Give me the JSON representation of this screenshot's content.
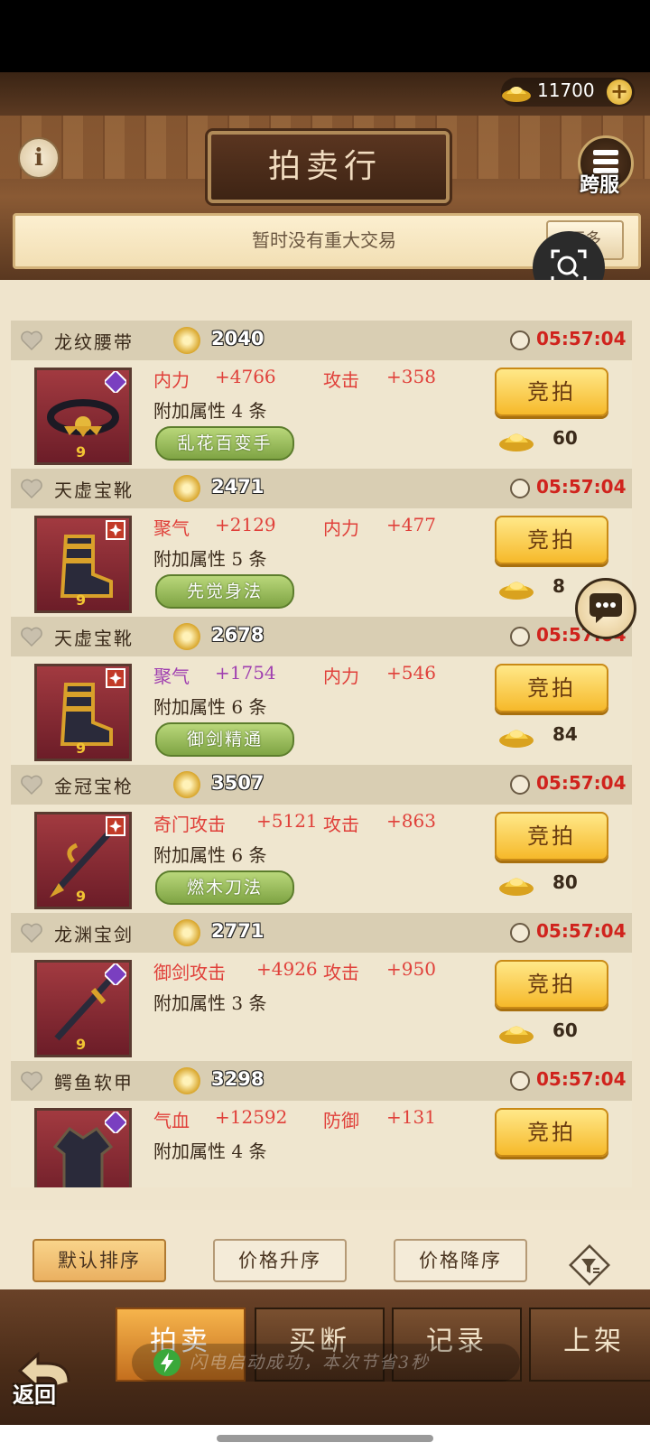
{
  "header": {
    "gold_amount": "11700",
    "plus": "+",
    "title": "拍卖行",
    "info": "i",
    "cross_server": "跨服"
  },
  "notice": {
    "text": "暂时没有重大交易",
    "more": "更多"
  },
  "items": [
    {
      "name": "龙纹腰带",
      "price": "2040",
      "timer": "05:57:04",
      "stat1_label": "内力",
      "stat1_value": "+4766",
      "stat1_color": "#e0403a",
      "stat2_label": "攻击",
      "stat2_value": "+358",
      "stat2_color": "#e0403a",
      "attr": "附加属性 4 条",
      "skill": "乱花百变手",
      "bid_label": "竞拍",
      "bid_cost": "60",
      "icon": "belt-icon",
      "badge": "purple-badge"
    },
    {
      "name": "天虚宝靴",
      "price": "2471",
      "timer": "05:57:04",
      "stat1_label": "聚气",
      "stat1_value": "+2129",
      "stat1_color": "#e0403a",
      "stat2_label": "内力",
      "stat2_value": "+477",
      "stat2_color": "#e0403a",
      "attr": "附加属性 5 条",
      "skill": "先觉身法",
      "bid_label": "竞拍",
      "bid_cost": "8",
      "icon": "boots-icon",
      "badge": "red-badge"
    },
    {
      "name": "天虚宝靴",
      "price": "2678",
      "timer": "05:57:04",
      "stat1_label": "聚气",
      "stat1_value": "+1754",
      "stat1_color": "#a040b0",
      "stat2_label": "内力",
      "stat2_value": "+546",
      "stat2_color": "#e0403a",
      "attr": "附加属性 6 条",
      "skill": "御剑精通",
      "bid_label": "竞拍",
      "bid_cost": "84",
      "icon": "boots-icon",
      "badge": "red-badge"
    },
    {
      "name": "金冠宝枪",
      "price": "3507",
      "timer": "05:57:04",
      "stat1_label": "奇门攻击",
      "stat1_value": "+5121",
      "stat1_color": "#e0403a",
      "stat2_label": "攻击",
      "stat2_value": "+863",
      "stat2_color": "#e0403a",
      "attr": "附加属性 6 条",
      "skill": "燃木刀法",
      "bid_label": "竞拍",
      "bid_cost": "80",
      "icon": "spear-icon",
      "badge": "red-badge"
    },
    {
      "name": "龙渊宝剑",
      "price": "2771",
      "timer": "05:57:04",
      "stat1_label": "御剑攻击",
      "stat1_value": "+4926",
      "stat1_color": "#e0403a",
      "stat2_label": "攻击",
      "stat2_value": "+950",
      "stat2_color": "#e0403a",
      "attr": "附加属性 3 条",
      "skill": "",
      "bid_label": "竞拍",
      "bid_cost": "60",
      "icon": "sword-icon",
      "badge": "purple-badge"
    },
    {
      "name": "鳄鱼软甲",
      "price": "3298",
      "timer": "05:57:04",
      "stat1_label": "气血",
      "stat1_value": "+12592",
      "stat1_color": "#e0403a",
      "stat2_label": "防御",
      "stat2_value": "+131",
      "stat2_color": "#e0403a",
      "attr": "附加属性 4 条",
      "skill": "",
      "bid_label": "竞拍",
      "bid_cost": "",
      "icon": "armor-icon",
      "badge": "purple-badge"
    }
  ],
  "sort": {
    "default": "默认排序",
    "asc": "价格升序",
    "desc": "价格降序"
  },
  "tabs": {
    "auction": "拍卖",
    "buyout": "买断",
    "record": "记录",
    "list": "上架"
  },
  "back": "返回",
  "toast": "闪电启动成功，本次节省3秒"
}
